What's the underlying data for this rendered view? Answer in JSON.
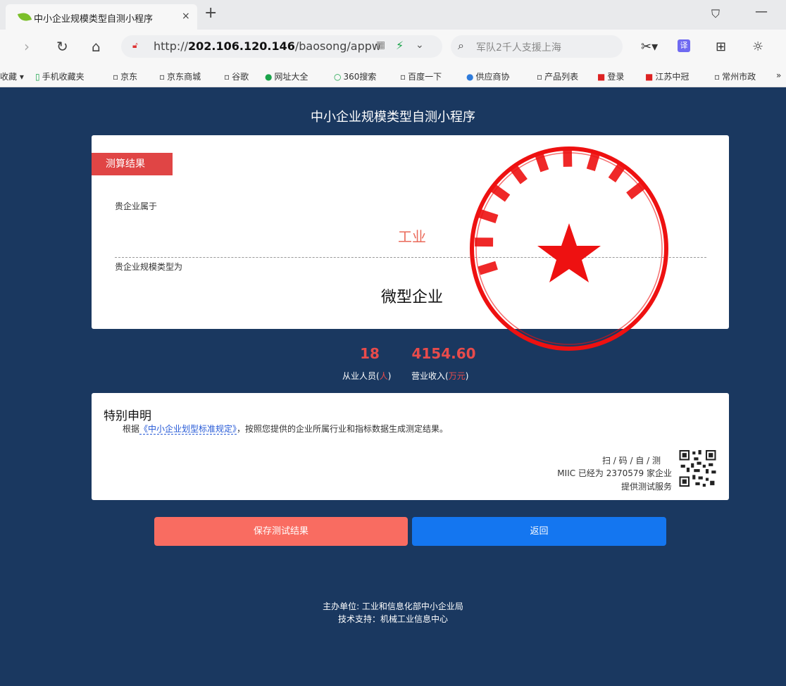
{
  "browser": {
    "tab_title": "中小企业规模类型自测小程序",
    "tab_close": "×",
    "new_tab": "+",
    "url_prefix": "http://",
    "url_host": "202.106.120.146",
    "url_path": "/baosong/appw",
    "search_text": "军队2千人支援上海",
    "translate_label": "译",
    "bookmarks": [
      {
        "icon": "▾",
        "label": "收藏"
      },
      {
        "icon": "▯",
        "label": "手机收藏夹"
      },
      {
        "icon": "▫",
        "label": "京东"
      },
      {
        "icon": "▫",
        "label": "京东商城"
      },
      {
        "icon": "▫",
        "label": "谷歌"
      },
      {
        "icon": "●",
        "label": "网址大全"
      },
      {
        "icon": "○",
        "label": "360搜索"
      },
      {
        "icon": "▫",
        "label": "百度一下"
      },
      {
        "icon": "●",
        "label": "供应商协"
      },
      {
        "icon": "▫",
        "label": "产品列表"
      },
      {
        "icon": "■",
        "label": "登录"
      },
      {
        "icon": "■",
        "label": "江苏中冠"
      },
      {
        "icon": "▫",
        "label": "常州市政"
      },
      {
        "icon": "»",
        "label": ""
      }
    ]
  },
  "page": {
    "title": "中小企业规模类型自测小程序",
    "result_tag": "测算结果",
    "belongs_label": "贵企业属于",
    "industry": "工业",
    "type_label": "贵企业规模类型为",
    "enterprise_type": "微型企业",
    "employees_value": "18",
    "revenue_value": "4154.60",
    "employees_caption": "从业人员(",
    "employees_unit": "人",
    "revenue_caption": "营业收入(",
    "revenue_unit": "万元",
    "close_paren": ")",
    "declaration_title": "特别申明",
    "declaration_prefix": "根据",
    "declaration_link": "《中小企业划型标准规定》",
    "declaration_suffix": "，按照您提供的企业所属行业和指标数据生成测定结果。",
    "scan_line1": "扫 / 码 / 自 / 测",
    "scan_line2": "MIIC 已经为 2370579 家企业",
    "scan_line3": "提供测试服务",
    "save_button": "保存测试结果",
    "back_button": "返回",
    "footer_host": "主办单位: 工业和信息化部中小企业局",
    "footer_support": "技术支持：机械工业信息中心"
  },
  "colors": {
    "page_bg": "#1a3860",
    "accent_red": "#e84b4b",
    "save_button": "#f96c61",
    "back_button": "#1476f0",
    "seal_red": "#ee1111"
  }
}
